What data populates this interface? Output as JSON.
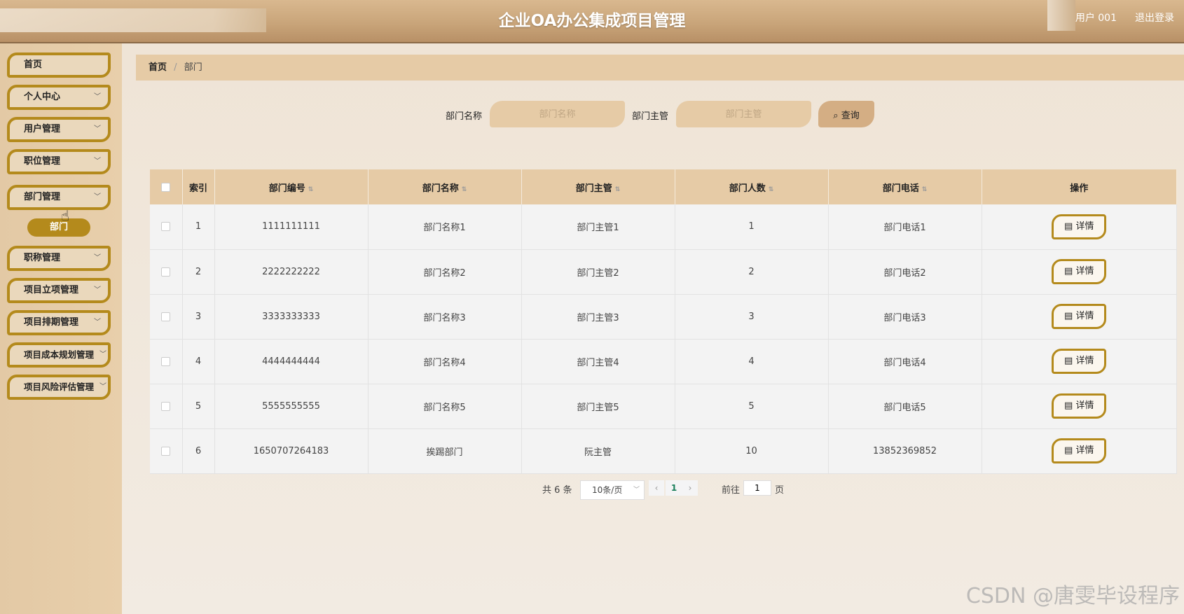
{
  "header": {
    "title": "企业OA办公集成项目管理",
    "user": "用户 001",
    "logout": "退出登录"
  },
  "sidebar": {
    "items": [
      {
        "label": "首页",
        "has_children": false
      },
      {
        "label": "个人中心",
        "has_children": true
      },
      {
        "label": "用户管理",
        "has_children": true
      },
      {
        "label": "职位管理",
        "has_children": true
      },
      {
        "label": "部门管理",
        "has_children": true
      },
      {
        "label": "职称管理",
        "has_children": true
      },
      {
        "label": "项目立项管理",
        "has_children": true
      },
      {
        "label": "项目排期管理",
        "has_children": true
      },
      {
        "label": "项目成本规划管理",
        "has_children": true
      },
      {
        "label": "项目风险评估管理",
        "has_children": true
      }
    ],
    "active_sub": "部门"
  },
  "breadcrumb": {
    "home": "首页",
    "separator": "/",
    "current": "部门"
  },
  "search": {
    "name_label": "部门名称",
    "name_placeholder": "部门名称",
    "manager_label": "部门主管",
    "manager_placeholder": "部门主管",
    "button": "查询"
  },
  "table": {
    "columns": [
      "索引",
      "部门编号",
      "部门名称",
      "部门主管",
      "部门人数",
      "部门电话",
      "操作"
    ],
    "action_label": "详情",
    "rows": [
      {
        "index": "1",
        "code": "1111111111",
        "name": "部门名称1",
        "manager": "部门主管1",
        "count": "1",
        "phone": "部门电话1"
      },
      {
        "index": "2",
        "code": "2222222222",
        "name": "部门名称2",
        "manager": "部门主管2",
        "count": "2",
        "phone": "部门电话2"
      },
      {
        "index": "3",
        "code": "3333333333",
        "name": "部门名称3",
        "manager": "部门主管3",
        "count": "3",
        "phone": "部门电话3"
      },
      {
        "index": "4",
        "code": "4444444444",
        "name": "部门名称4",
        "manager": "部门主管4",
        "count": "4",
        "phone": "部门电话4"
      },
      {
        "index": "5",
        "code": "5555555555",
        "name": "部门名称5",
        "manager": "部门主管5",
        "count": "5",
        "phone": "部门电话5"
      },
      {
        "index": "6",
        "code": "1650707264183",
        "name": "挨踢部门",
        "manager": "阮主管",
        "count": "10",
        "phone": "13852369852"
      }
    ]
  },
  "pagination": {
    "total": "共 6 条",
    "page_size": "10条/页",
    "prev": "‹",
    "current_page": "1",
    "next": "›",
    "goto_label": "前往",
    "goto_value": "1",
    "page_suffix": "页"
  },
  "watermark": "CSDN @唐雯毕设程序"
}
